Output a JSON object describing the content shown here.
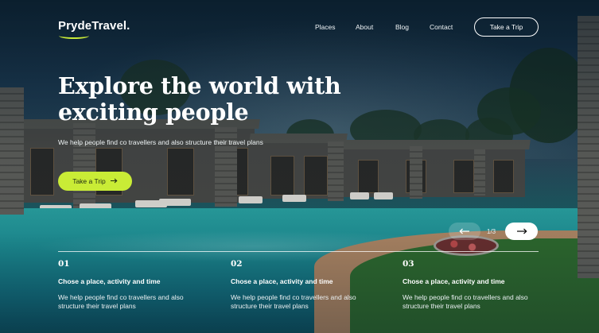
{
  "brand": {
    "name": "PrydeTravel.",
    "accent": "#c9ec36"
  },
  "nav": {
    "links": [
      "Places",
      "About",
      "Blog",
      "Contact"
    ],
    "cta_label": "Take a Trip"
  },
  "hero": {
    "headline": "Explore the world with exciting people",
    "subhead": "We help people find co travellers and also structure their travel plans",
    "cta_label": "Take a Trip",
    "cta_icon": "arrow-right-icon"
  },
  "slider": {
    "current": "1",
    "total": "3",
    "counter": "1/3",
    "prev_icon": "arrow-left-icon",
    "next_icon": "arrow-right-icon"
  },
  "features": [
    {
      "number": "01",
      "title": "Chose a place, activity and time",
      "description": "We help people find co travellers and also structure their travel plans"
    },
    {
      "number": "02",
      "title": "Chose a place, activity and time",
      "description": "We help people find co travellers and also structure their travel plans"
    },
    {
      "number": "03",
      "title": "Chose a place, activity and time",
      "description": "We help people find co travellers and also structure their travel plans"
    }
  ]
}
